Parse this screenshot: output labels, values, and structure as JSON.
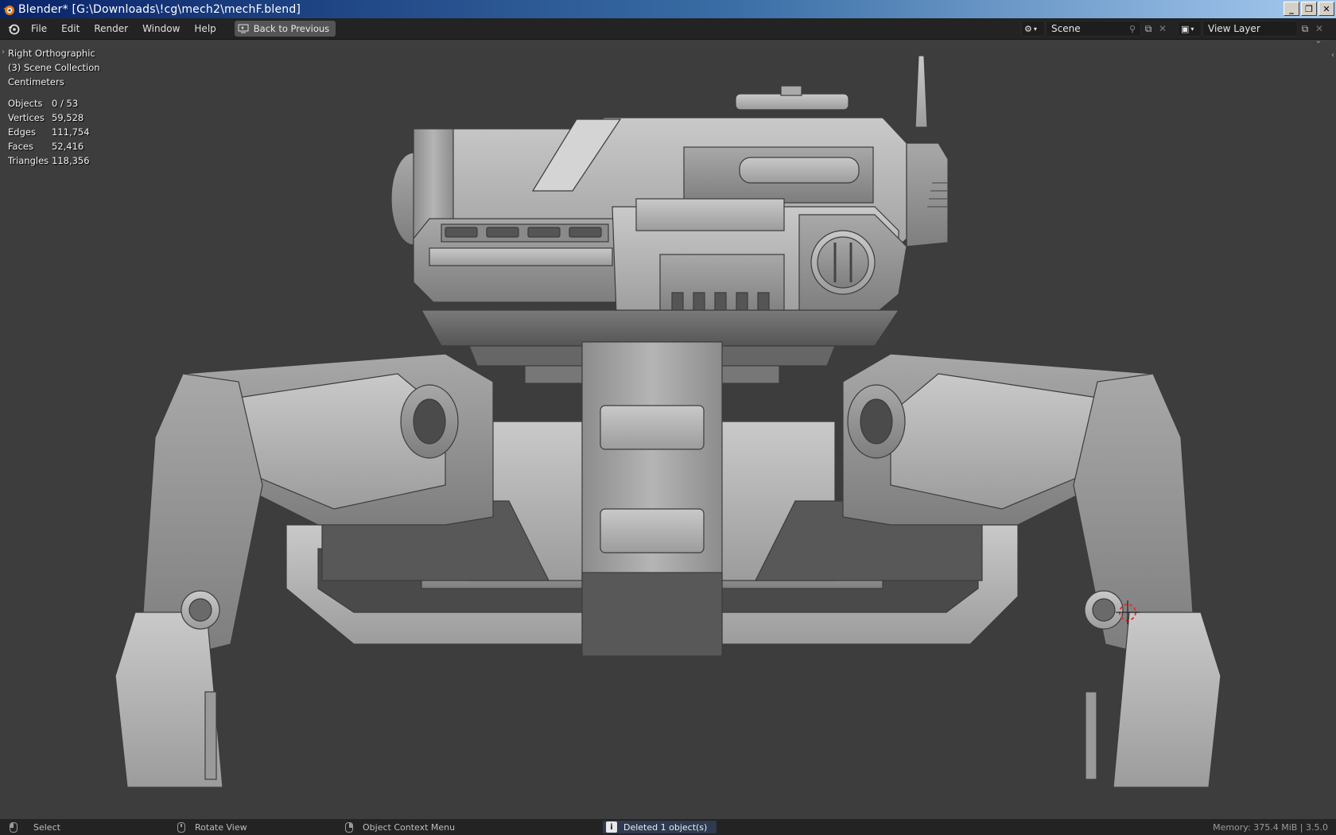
{
  "window": {
    "title": "Blender* [G:\\Downloads\\!cg\\mech2\\mechF.blend]",
    "buttons": {
      "minimize": "_",
      "restore": "❐",
      "close": "✕"
    }
  },
  "menu": {
    "items": [
      "File",
      "Edit",
      "Render",
      "Window",
      "Help"
    ],
    "back_button": "Back to Previous"
  },
  "scene_selector": {
    "value": "Scene"
  },
  "view_layer_selector": {
    "value": "View Layer"
  },
  "viewport": {
    "view_name": "Right Orthographic",
    "collection": "(3) Scene Collection",
    "units": "Centimeters",
    "stats": [
      {
        "label": "Objects",
        "value": "0 / 53"
      },
      {
        "label": "Vertices",
        "value": "59,528"
      },
      {
        "label": "Edges",
        "value": "111,754"
      },
      {
        "label": "Faces",
        "value": "52,416"
      },
      {
        "label": "Triangles",
        "value": "118,356"
      }
    ]
  },
  "statusbar": {
    "select": "Select",
    "rotate": "Rotate View",
    "context_menu": "Object Context Menu",
    "report": "Deleted 1 object(s)",
    "memory": "Memory: 375.4 MiB | 3.5.0"
  },
  "colors": {
    "viewport_bg": "#3d3d3d",
    "topbar_bg": "#232323",
    "mesh_light": "#b8b8b8",
    "mesh_dark": "#6a6a6a"
  }
}
